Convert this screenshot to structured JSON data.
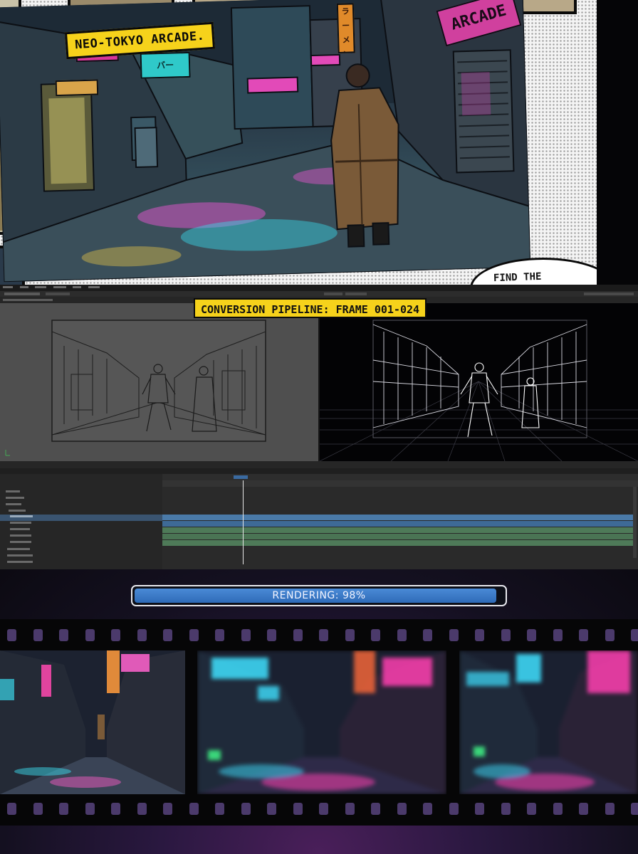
{
  "comic": {
    "caption": "NEO-TOKYO ARCADE.",
    "bubble_text": "FIND THE",
    "signs": [
      "ARCADE",
      "ラーメン",
      "バー"
    ]
  },
  "editor": {
    "pipeline_label": "CONVERSION PIPELINE: FRAME 001-024",
    "colors": {
      "panel_bg": "#232323",
      "timeline_bg": "#2a2a2a",
      "clip_blue": "#4a7aa8",
      "clip_green": "#4e7a58",
      "label_yellow": "#f6d21b"
    }
  },
  "render": {
    "progress_label": "RENDERING: 98%",
    "progress_fraction": 0.98,
    "colors": {
      "fill": "#2f6bb8",
      "neon_pink": "#ff3fb0",
      "neon_cyan": "#3fe0ff"
    }
  }
}
